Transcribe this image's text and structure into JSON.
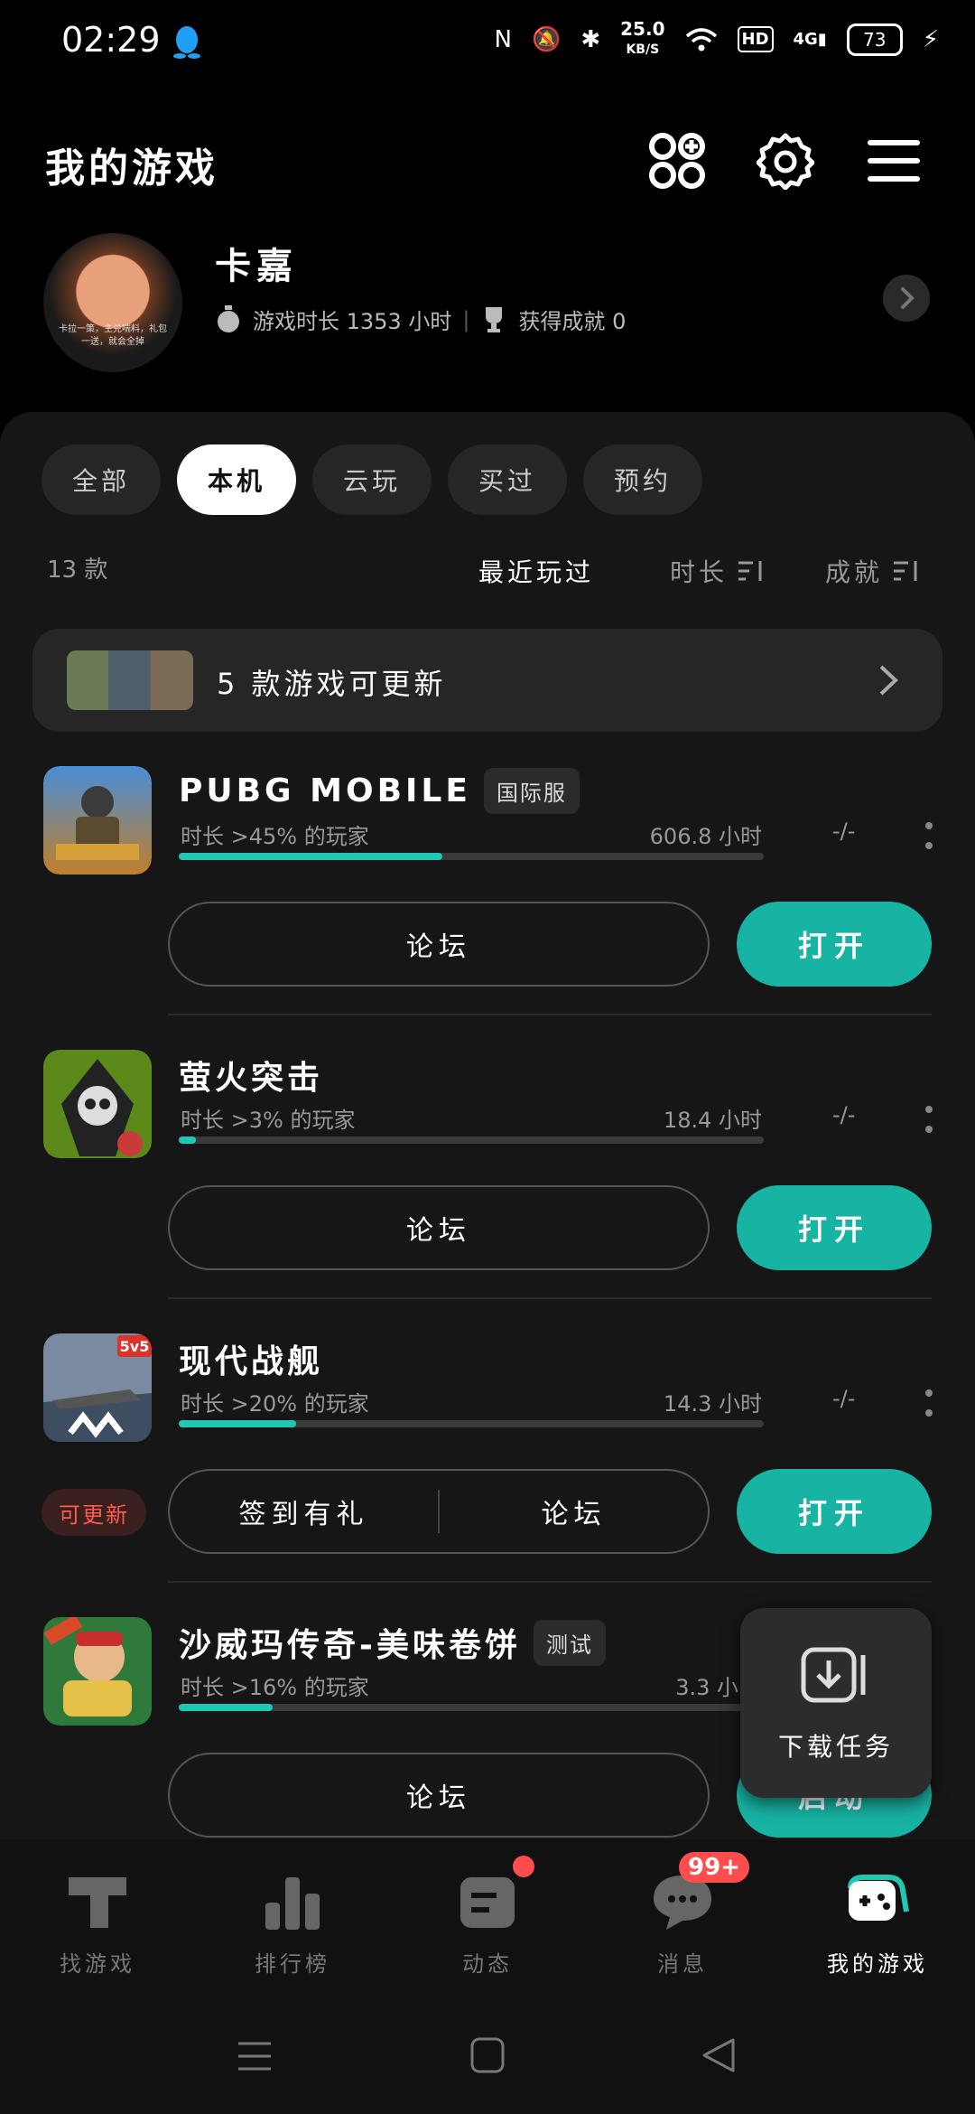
{
  "status_bar": {
    "time": "02:29",
    "speed_value": "25.0",
    "speed_unit": "KB/S",
    "hd": "HD",
    "network": "4G",
    "battery": "73"
  },
  "header": {
    "title": "我的游戏"
  },
  "profile": {
    "name": "卡嘉",
    "avatar_caption": "卡拉一策，主兑喘料，礼包一送，就会全掉",
    "playtime": "游戏时长 1353 小时",
    "achievements": "获得成就 0"
  },
  "tabs": [
    {
      "label": "全部",
      "active": false
    },
    {
      "label": "本机",
      "active": true
    },
    {
      "label": "云玩",
      "active": false
    },
    {
      "label": "买过",
      "active": false
    },
    {
      "label": "预约",
      "active": false
    }
  ],
  "list_meta": {
    "count": "13 款",
    "sort_recent": "最近玩过",
    "sort_time": "时长",
    "sort_achievement": "成就"
  },
  "update_banner": {
    "text": "5 款游戏可更新"
  },
  "games": [
    {
      "name": "PUBG MOBILE",
      "badge": "国际服",
      "stat": "时长 >45% 的玩家",
      "hours": "606.8 小时",
      "rank": "-/-",
      "progress": 0.45,
      "forum": "论坛",
      "checkin": "",
      "open": "打开",
      "updatable": ""
    },
    {
      "name": "萤火突击",
      "badge": "",
      "stat": "时长 >3% 的玩家",
      "hours": "18.4 小时",
      "rank": "-/-",
      "progress": 0.03,
      "forum": "论坛",
      "checkin": "",
      "open": "打开",
      "updatable": ""
    },
    {
      "name": "现代战舰",
      "badge": "",
      "stat": "时长 >20% 的玩家",
      "hours": "14.3 小时",
      "rank": "-/-",
      "progress": 0.2,
      "forum": "论坛",
      "checkin": "签到有礼",
      "open": "打开",
      "updatable": "可更新"
    },
    {
      "name": "沙威玛传奇-美味卷饼",
      "badge": "测试",
      "stat": "时长 >16% 的玩家",
      "hours": "3.3 小",
      "rank": "",
      "progress": 0.16,
      "forum": "论坛",
      "checkin": "",
      "open": "启动",
      "updatable": ""
    }
  ],
  "game_icon_text": {
    "modern_warships": "5v5"
  },
  "float_task": {
    "label": "下载任务"
  },
  "bottom_nav": [
    {
      "label": "找游戏",
      "icon": "find-games-icon"
    },
    {
      "label": "排行榜",
      "icon": "leaderboard-icon"
    },
    {
      "label": "动态",
      "icon": "feed-icon"
    },
    {
      "label": "消息",
      "icon": "message-icon",
      "badge": "99+"
    },
    {
      "label": "我的游戏",
      "icon": "my-games-icon",
      "active": true
    }
  ],
  "colors": {
    "accent": "#17b3a3",
    "progress": "#1fc8b4",
    "alert": "#ff4d4d",
    "qq_blue": "#1ea0f5"
  }
}
